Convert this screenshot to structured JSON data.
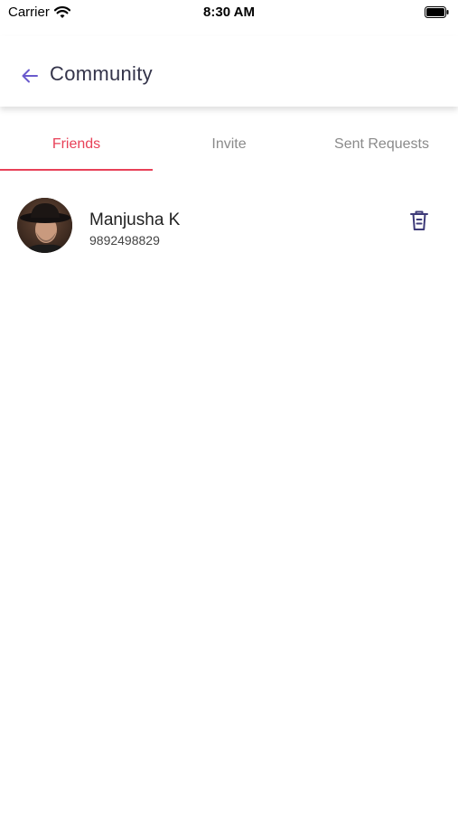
{
  "status_bar": {
    "carrier": "Carrier",
    "time": "8:30 AM"
  },
  "header": {
    "title": "Community",
    "back_icon": "arrow-left-icon",
    "accent_color": "#6a5acd"
  },
  "tabs": [
    {
      "label": "Friends",
      "active": true
    },
    {
      "label": "Invite",
      "active": false
    },
    {
      "label": "Sent Requests",
      "active": false
    }
  ],
  "colors": {
    "active_tab": "#e84158",
    "inactive_tab": "#8a8a8a",
    "title": "#34344a",
    "icon": "#3d3a78"
  },
  "friends": [
    {
      "name": "Manjusha K",
      "phone": "9892498829",
      "action_icon": "trash-icon"
    }
  ]
}
